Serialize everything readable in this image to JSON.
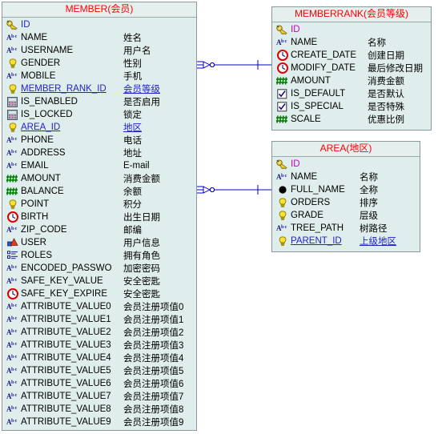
{
  "diagram": {
    "title": "ER Diagram",
    "colors": {
      "entity_fill": "#dfeeec",
      "entity_border": "#8a9a9a",
      "header_text": "#ff0000",
      "fk_text": "#2222cc",
      "pk_text": "#cc00cc",
      "connector": "#0000cc"
    }
  },
  "entities": [
    {
      "id": "member",
      "title": "MEMBER(会员)",
      "attributes": [
        {
          "icon": "key-icon",
          "name": "ID",
          "comment": "",
          "style": "pk"
        },
        {
          "icon": "abc-icon",
          "name": "NAME",
          "comment": "姓名",
          "style": ""
        },
        {
          "icon": "abc-icon",
          "name": "USERNAME",
          "comment": "用户名",
          "style": ""
        },
        {
          "icon": "bulb-icon",
          "name": "GENDER",
          "comment": "性别",
          "style": ""
        },
        {
          "icon": "abc-icon",
          "name": "MOBILE",
          "comment": "手机",
          "style": ""
        },
        {
          "icon": "bulb-icon",
          "name": "MEMBER_RANK_ID",
          "comment": "会员等级",
          "style": "fk"
        },
        {
          "icon": "grid-icon",
          "name": "IS_ENABLED",
          "comment": "是否启用",
          "style": ""
        },
        {
          "icon": "grid-icon",
          "name": "IS_LOCKED",
          "comment": "锁定",
          "style": ""
        },
        {
          "icon": "bulb-icon",
          "name": "AREA_ID",
          "comment": "地区",
          "style": "fk"
        },
        {
          "icon": "abc-icon",
          "name": "PHONE",
          "comment": "电话",
          "style": ""
        },
        {
          "icon": "abc-icon",
          "name": "ADDRESS",
          "comment": "地址",
          "style": ""
        },
        {
          "icon": "abc-icon",
          "name": "EMAIL",
          "comment": "E-mail",
          "style": ""
        },
        {
          "icon": "number-icon",
          "name": "AMOUNT",
          "comment": "消费金额",
          "style": ""
        },
        {
          "icon": "number-icon",
          "name": "BALANCE",
          "comment": "余额",
          "style": ""
        },
        {
          "icon": "bulb-icon",
          "name": "POINT",
          "comment": "积分",
          "style": ""
        },
        {
          "icon": "clock-icon",
          "name": "BIRTH",
          "comment": "出生日期",
          "style": ""
        },
        {
          "icon": "abc-icon",
          "name": "ZIP_CODE",
          "comment": "邮编",
          "style": ""
        },
        {
          "icon": "object-icon",
          "name": "USER",
          "comment": "用户信息",
          "style": ""
        },
        {
          "icon": "list-icon",
          "name": "ROLES",
          "comment": "拥有角色",
          "style": ""
        },
        {
          "icon": "abc-icon",
          "name": "ENCODED_PASSWO",
          "comment": "加密密码",
          "style": ""
        },
        {
          "icon": "abc-icon",
          "name": "SAFE_KEY_VALUE",
          "comment": "安全密匙",
          "style": ""
        },
        {
          "icon": "clock-icon",
          "name": "SAFE_KEY_EXPIRE",
          "comment": "安全密匙",
          "style": ""
        },
        {
          "icon": "abc-icon",
          "name": "ATTRIBUTE_VALUE0",
          "comment": "会员注册项值0",
          "style": ""
        },
        {
          "icon": "abc-icon",
          "name": "ATTRIBUTE_VALUE1",
          "comment": "会员注册项值1",
          "style": ""
        },
        {
          "icon": "abc-icon",
          "name": "ATTRIBUTE_VALUE2",
          "comment": "会员注册项值2",
          "style": ""
        },
        {
          "icon": "abc-icon",
          "name": "ATTRIBUTE_VALUE3",
          "comment": "会员注册项值3",
          "style": ""
        },
        {
          "icon": "abc-icon",
          "name": "ATTRIBUTE_VALUE4",
          "comment": "会员注册项值4",
          "style": ""
        },
        {
          "icon": "abc-icon",
          "name": "ATTRIBUTE_VALUE5",
          "comment": "会员注册项值5",
          "style": ""
        },
        {
          "icon": "abc-icon",
          "name": "ATTRIBUTE_VALUE6",
          "comment": "会员注册项值6",
          "style": ""
        },
        {
          "icon": "abc-icon",
          "name": "ATTRIBUTE_VALUE7",
          "comment": "会员注册项值7",
          "style": ""
        },
        {
          "icon": "abc-icon",
          "name": "ATTRIBUTE_VALUE8",
          "comment": "会员注册项值8",
          "style": ""
        },
        {
          "icon": "abc-icon",
          "name": "ATTRIBUTE_VALUE9",
          "comment": "会员注册项值9",
          "style": ""
        }
      ]
    },
    {
      "id": "memberrank",
      "title": "MEMBERRANK(会员等级)",
      "attributes": [
        {
          "icon": "key-icon",
          "name": "ID",
          "comment": "",
          "style": "pkmagenta"
        },
        {
          "icon": "abc-icon",
          "name": "NAME",
          "comment": "名称",
          "style": ""
        },
        {
          "icon": "clock-icon",
          "name": "CREATE_DATE",
          "comment": "创建日期",
          "style": ""
        },
        {
          "icon": "clock-icon",
          "name": "MODIFY_DATE",
          "comment": "最后修改日期",
          "style": ""
        },
        {
          "icon": "number-icon",
          "name": "AMOUNT",
          "comment": "消费金额",
          "style": ""
        },
        {
          "icon": "checkbox-icon",
          "name": "IS_DEFAULT",
          "comment": "是否默认",
          "style": ""
        },
        {
          "icon": "checkbox-icon",
          "name": "IS_SPECIAL",
          "comment": "是否特殊",
          "style": ""
        },
        {
          "icon": "number-icon",
          "name": "SCALE",
          "comment": "优惠比例",
          "style": ""
        }
      ]
    },
    {
      "id": "area",
      "title": "AREA(地区)",
      "attributes": [
        {
          "icon": "key-icon",
          "name": "ID",
          "comment": "",
          "style": "pkmagenta"
        },
        {
          "icon": "abc-icon",
          "name": "NAME",
          "comment": "名称",
          "style": ""
        },
        {
          "icon": "circle-icon",
          "name": "FULL_NAME",
          "comment": "全称",
          "style": ""
        },
        {
          "icon": "bulb-icon",
          "name": "ORDERS",
          "comment": "排序",
          "style": ""
        },
        {
          "icon": "bulb-icon",
          "name": "GRADE",
          "comment": "层级",
          "style": ""
        },
        {
          "icon": "abc-icon",
          "name": "TREE_PATH",
          "comment": "树路径",
          "style": ""
        },
        {
          "icon": "bulb-icon",
          "name": "PARENT_ID",
          "comment": "上级地区",
          "style": "fk"
        }
      ]
    }
  ],
  "relationships": [
    {
      "id": "member-to-memberrank",
      "from": "member",
      "to": "memberrank",
      "from_cardinality": "zero-or-many",
      "to_cardinality": "one"
    },
    {
      "id": "member-to-area",
      "from": "member",
      "to": "area",
      "from_cardinality": "zero-or-many",
      "to_cardinality": "one"
    }
  ]
}
